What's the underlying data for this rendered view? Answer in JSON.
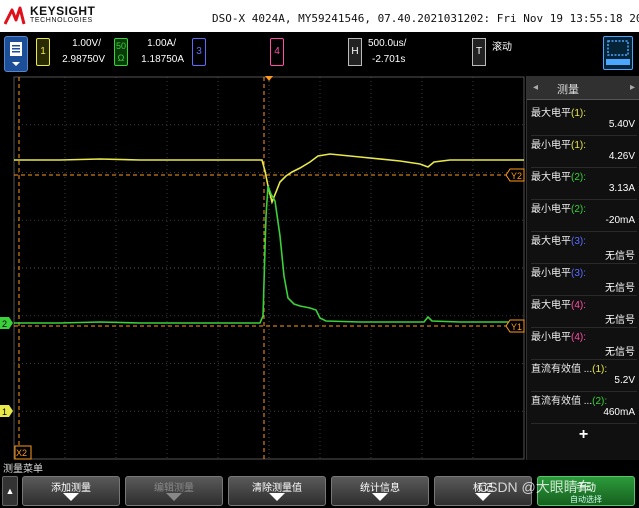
{
  "header": {
    "brand": "KEYSIGHT",
    "brand_sub": "TECHNOLOGIES",
    "device_info": "DSO-X 4024A, MY59241546, 07.40.2021031202: Fri Nov 19 13:55:18 2021"
  },
  "channels": {
    "ch1": {
      "number": "1",
      "scale": "1.00V/",
      "offset": "2.98750V",
      "color": "#e8e84a"
    },
    "ch2": {
      "number": "2",
      "impedance": "50\nΩ",
      "impedance_top": "50",
      "impedance_bottom": "Ω",
      "scale": "1.00A/",
      "offset": "1.18750A",
      "color": "#3ad13a"
    },
    "ch3": {
      "number": "3",
      "color": "#5b6cff"
    },
    "ch4": {
      "number": "4",
      "color": "#ff4fa6"
    }
  },
  "timebase": {
    "badge": "H",
    "scale": "500.0us/",
    "delay": "-2.701s"
  },
  "trigger": {
    "badge": "T",
    "mode": "滚动"
  },
  "markers": {
    "y2": "Y2",
    "y1": "Y1",
    "x2": "X2",
    "ch2_marker": "2",
    "ch1_marker": "1"
  },
  "measurements": {
    "title": "测量",
    "items": [
      {
        "label": "最大电平",
        "src": "(1):",
        "src_color": "#e8e84a",
        "value": "5.40V"
      },
      {
        "label": "最小电平",
        "src": "(1):",
        "src_color": "#e8e84a",
        "value": "4.26V"
      },
      {
        "label": "最大电平",
        "src": "(2):",
        "src_color": "#3ad13a",
        "value": "3.13A"
      },
      {
        "label": "最小电平",
        "src": "(2):",
        "src_color": "#3ad13a",
        "value": "-20mA"
      },
      {
        "label": "最大电平",
        "src": "(3):",
        "src_color": "#5b6cff",
        "value": "无信号"
      },
      {
        "label": "最小电平",
        "src": "(3):",
        "src_color": "#5b6cff",
        "value": "无信号"
      },
      {
        "label": "最大电平",
        "src": "(4):",
        "src_color": "#ff4fa6",
        "value": "无信号"
      },
      {
        "label": "最小电平",
        "src": "(4):",
        "src_color": "#ff4fa6",
        "value": "无信号"
      },
      {
        "label": "直流有效值 ...",
        "src": "(1):",
        "src_color": "#e8e84a",
        "value": "5.2V"
      },
      {
        "label": "直流有效值 ...",
        "src": "(2):",
        "src_color": "#3ad13a",
        "value": "460mA"
      }
    ],
    "add_symbol": "+"
  },
  "softkeys": {
    "menu_title": "测量菜单",
    "keys": [
      {
        "label": "添加测量",
        "enabled": true
      },
      {
        "label": "编辑测量",
        "enabled": false
      },
      {
        "label": "清除测量值",
        "enabled": true
      },
      {
        "label": "统计信息",
        "enabled": true
      },
      {
        "label": "标记",
        "enabled": true
      },
      {
        "label": "手动",
        "sub": "自动选择",
        "enabled": true
      }
    ],
    "watermark": "CSDN @大眼睛车"
  }
}
